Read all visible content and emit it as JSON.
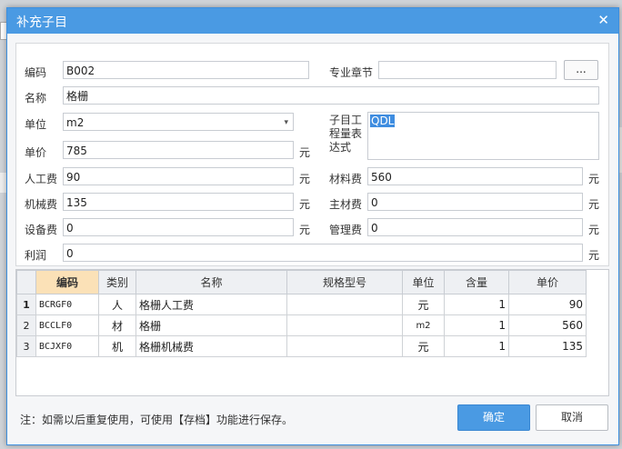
{
  "dialog": {
    "title": "补充子目",
    "close_glyph": "✕"
  },
  "form": {
    "code_label": "编码",
    "code_value": "B002",
    "chapter_label": "专业章节",
    "chapter_value": "",
    "chapter_button": "...",
    "name_label": "名称",
    "name_value": "格栅",
    "unit_label": "单位",
    "unit_value": "m2",
    "expr_label": "子目工程量表达式",
    "expr_label_lines": [
      "子目工",
      "程量表",
      "达式"
    ],
    "expr_value": "QDL",
    "price_label": "单价",
    "price_value": "785",
    "labor_label": "人工费",
    "labor_value": "90",
    "material_label": "材料费",
    "material_value": "560",
    "machine_label": "机械费",
    "machine_value": "135",
    "main_material_label": "主材费",
    "main_material_value": "0",
    "equipment_label": "设备费",
    "equipment_value": "0",
    "management_label": "管理费",
    "management_value": "0",
    "profit_label": "利润",
    "profit_value": "0",
    "currency_unit": "元"
  },
  "grid": {
    "headers": [
      "编码",
      "类别",
      "名称",
      "规格型号",
      "单位",
      "含量",
      "单价"
    ],
    "rows": [
      {
        "num": "1",
        "code": "BCRGF0",
        "type": "人",
        "name": "格栅人工费",
        "spec": "",
        "unit": "元",
        "qty": "1",
        "price": "90"
      },
      {
        "num": "2",
        "code": "BCCLF0",
        "type": "材",
        "name": "格栅",
        "spec": "",
        "unit": "m2",
        "qty": "1",
        "price": "560"
      },
      {
        "num": "3",
        "code": "BCJXF0",
        "type": "机",
        "name": "格栅机械费",
        "spec": "",
        "unit": "元",
        "qty": "1",
        "price": "135"
      }
    ]
  },
  "footer": {
    "note": "注：如需以后重复使用，可使用【存档】功能进行保存。",
    "ok_label": "确定",
    "cancel_label": "取消"
  },
  "colors": {
    "titlebar": "#4a9ae3",
    "active_header": "#fbe1b7",
    "selection": "#3f8de0"
  }
}
